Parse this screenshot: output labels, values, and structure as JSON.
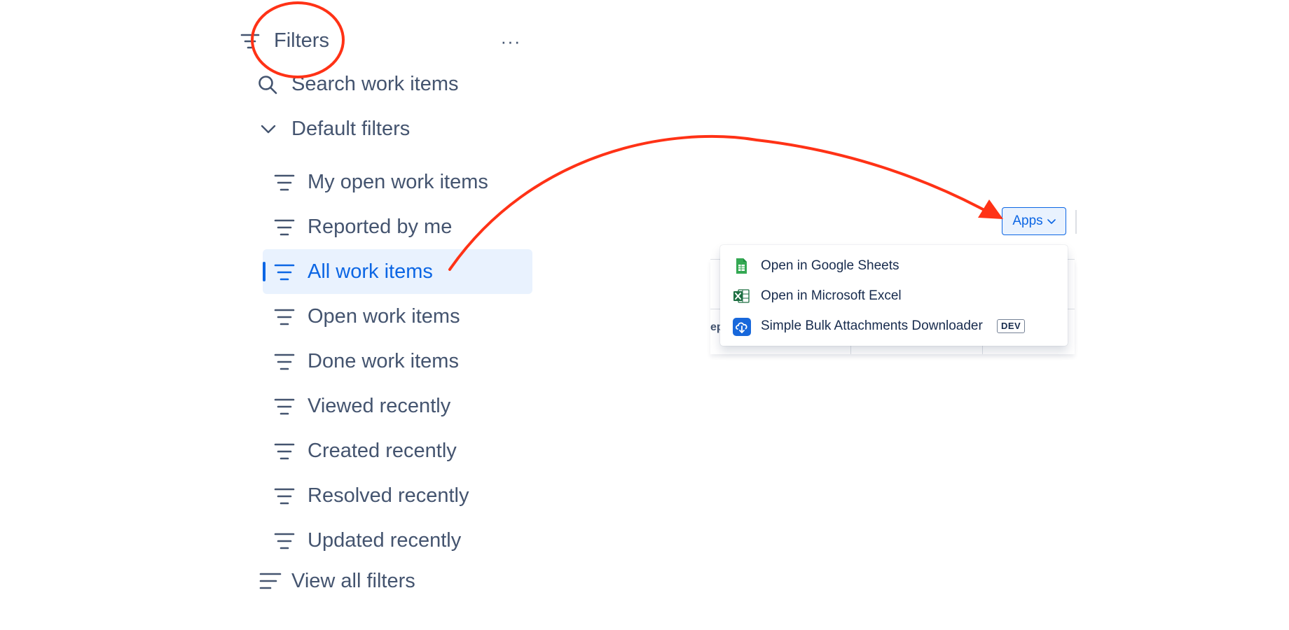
{
  "sidebar": {
    "title": "Filters",
    "more_label": "···",
    "search_label": "Search work items",
    "default_filters_label": "Default filters",
    "items": [
      {
        "label": "My open work items"
      },
      {
        "label": "Reported by me"
      },
      {
        "label": "All work items",
        "active": true
      },
      {
        "label": "Open work items"
      },
      {
        "label": "Done work items"
      },
      {
        "label": "Viewed recently"
      },
      {
        "label": "Created recently"
      },
      {
        "label": "Resolved recently"
      },
      {
        "label": "Updated recently"
      }
    ],
    "view_all_label": "View all filters"
  },
  "toolbar": {
    "apps_label": "Apps"
  },
  "apps_menu": {
    "items": [
      {
        "label": "Open in Google Sheets",
        "icon": "google-sheets-icon"
      },
      {
        "label": "Open in Microsoft Excel",
        "icon": "microsoft-excel-icon"
      },
      {
        "label": "Simple Bulk Attachments Downloader",
        "icon": "cloud-download-icon",
        "badge": "DEV"
      }
    ]
  },
  "table": {
    "partial_header_text": "ep"
  },
  "colors": {
    "accent": "#0c66e4",
    "active_bg": "#e9f2fe",
    "text": "#44546f",
    "annotation": "#ff3216",
    "sheets_green": "#34a853",
    "excel_green": "#1d6f42",
    "app_blue": "#1868db"
  }
}
